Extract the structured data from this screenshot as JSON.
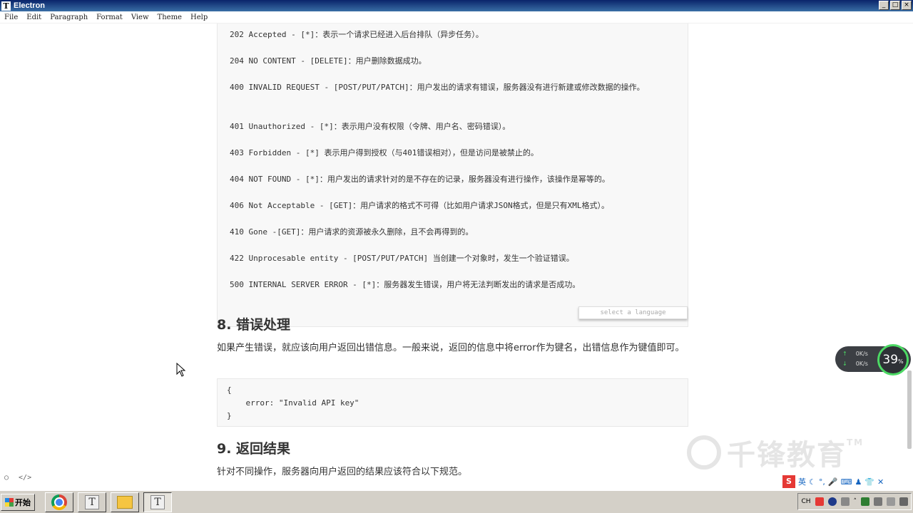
{
  "window": {
    "title": "Electron",
    "minimize_label": "_",
    "maximize_label": "□",
    "close_label": "×"
  },
  "menu": [
    "File",
    "Edit",
    "Paragraph",
    "Format",
    "View",
    "Theme",
    "Help"
  ],
  "status_codes": [
    "202 Accepted - [*]：表示一个请求已经进入后台排队（异步任务）。",
    "204 NO CONTENT - [DELETE]：用户删除数据成功。",
    "400 INVALID REQUEST - [POST/PUT/PATCH]：用户发出的请求有错误，服务器没有进行新建或修改数据的操作。",
    "401 Unauthorized - [*]：表示用户没有权限（令牌、用户名、密码错误）。",
    "403 Forbidden - [*] 表示用户得到授权（与401错误相对），但是访问是被禁止的。",
    "404 NOT FOUND - [*]：用户发出的请求针对的是不存在的记录，服务器没有进行操作，该操作是幂等的。",
    "406 Not Acceptable - [GET]：用户请求的格式不可得（比如用户请求JSON格式，但是只有XML格式）。",
    "410 Gone -[GET]：用户请求的资源被永久删除，且不会再得到的。",
    "422 Unprocesable entity - [POST/PUT/PATCH] 当创建一个对象时，发生一个验证错误。",
    "500 INTERNAL SERVER ERROR - [*]：服务器发生错误，用户将无法判断发出的请求是否成功。"
  ],
  "code_lang_placeholder": "select a language",
  "section8": {
    "heading": "8. 错误处理",
    "paragraph": "如果产生错误，就应该向用户返回出错信息。一般来说，返回的信息中将error作为键名，出错信息作为键值即可。",
    "code": [
      "{",
      "    error: \"Invalid API key\"",
      "}"
    ]
  },
  "section9": {
    "heading": "9. 返回结果",
    "paragraph": "针对不同操作，服务器向用户返回的结果应该符合以下规范。"
  },
  "footer_icons": [
    "○",
    "</>"
  ],
  "net_widget": {
    "up": "0K/s",
    "down": "0K/s",
    "percent": "39",
    "percent_unit": "%"
  },
  "watermark": {
    "text": "千锋教育",
    "tm": "TM"
  },
  "ime": {
    "logo": "S",
    "lang": "英"
  },
  "taskbar": {
    "start_label": "开始",
    "tray_lang": "CH"
  },
  "colors": {
    "titlebar": "#0a246a",
    "accent_green": "#4cd964",
    "taskbar": "#d4d0c8"
  }
}
